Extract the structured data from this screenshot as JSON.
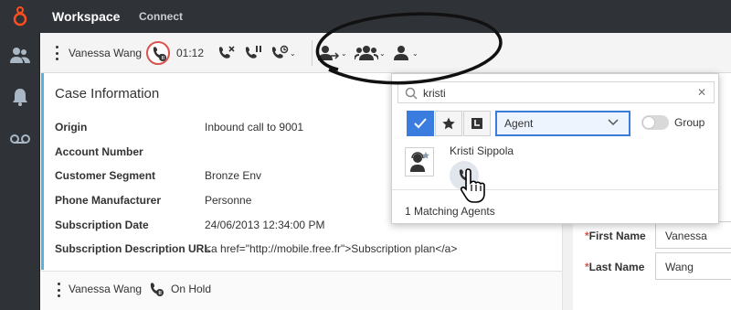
{
  "app": {
    "title": "Workspace",
    "tab": "Connect"
  },
  "sidebar": {
    "items": [
      {
        "icon": "contacts-icon"
      },
      {
        "icon": "bell-icon"
      },
      {
        "icon": "voicemail-icon"
      }
    ]
  },
  "interaction": {
    "caller": "Vanessa Wang",
    "timer": "01:12",
    "tools": [
      "end-call-icon",
      "hold-call-icon",
      "instant-transfer-icon",
      "transfer-icon",
      "conference-icon",
      "consult-icon"
    ]
  },
  "case": {
    "title": "Case Information",
    "rows": [
      {
        "label": "Origin",
        "value": "Inbound call to 9001"
      },
      {
        "label": "Account Number",
        "value": ""
      },
      {
        "label": "Customer Segment",
        "value": "Bronze Env"
      },
      {
        "label": "Phone Manufacturer",
        "value": "Personne"
      },
      {
        "label": "Subscription Date",
        "value": "24/06/2013 12:34:00 PM"
      },
      {
        "label": "Subscription Description URL",
        "value": "<a href=\"http://mobile.free.fr\">Subscription plan</a>"
      }
    ]
  },
  "bottom": {
    "caller": "Vanessa Wang",
    "status": "On Hold"
  },
  "contact": {
    "first_name_label": "First Name",
    "first_name": "Vanessa",
    "last_name_label": "Last Name",
    "last_name": "Wang",
    "required_mark": "*"
  },
  "team_communicator": {
    "search": "kristi",
    "type_selected": "Agent",
    "group_label": "Group",
    "result_name": "Kristi Sippola",
    "match_count": "1 Matching Agents"
  },
  "colors": {
    "accent": "#3b7dde",
    "alert": "#d9534f",
    "dark": "#2f3237",
    "case_border": "#5ab0d6"
  }
}
